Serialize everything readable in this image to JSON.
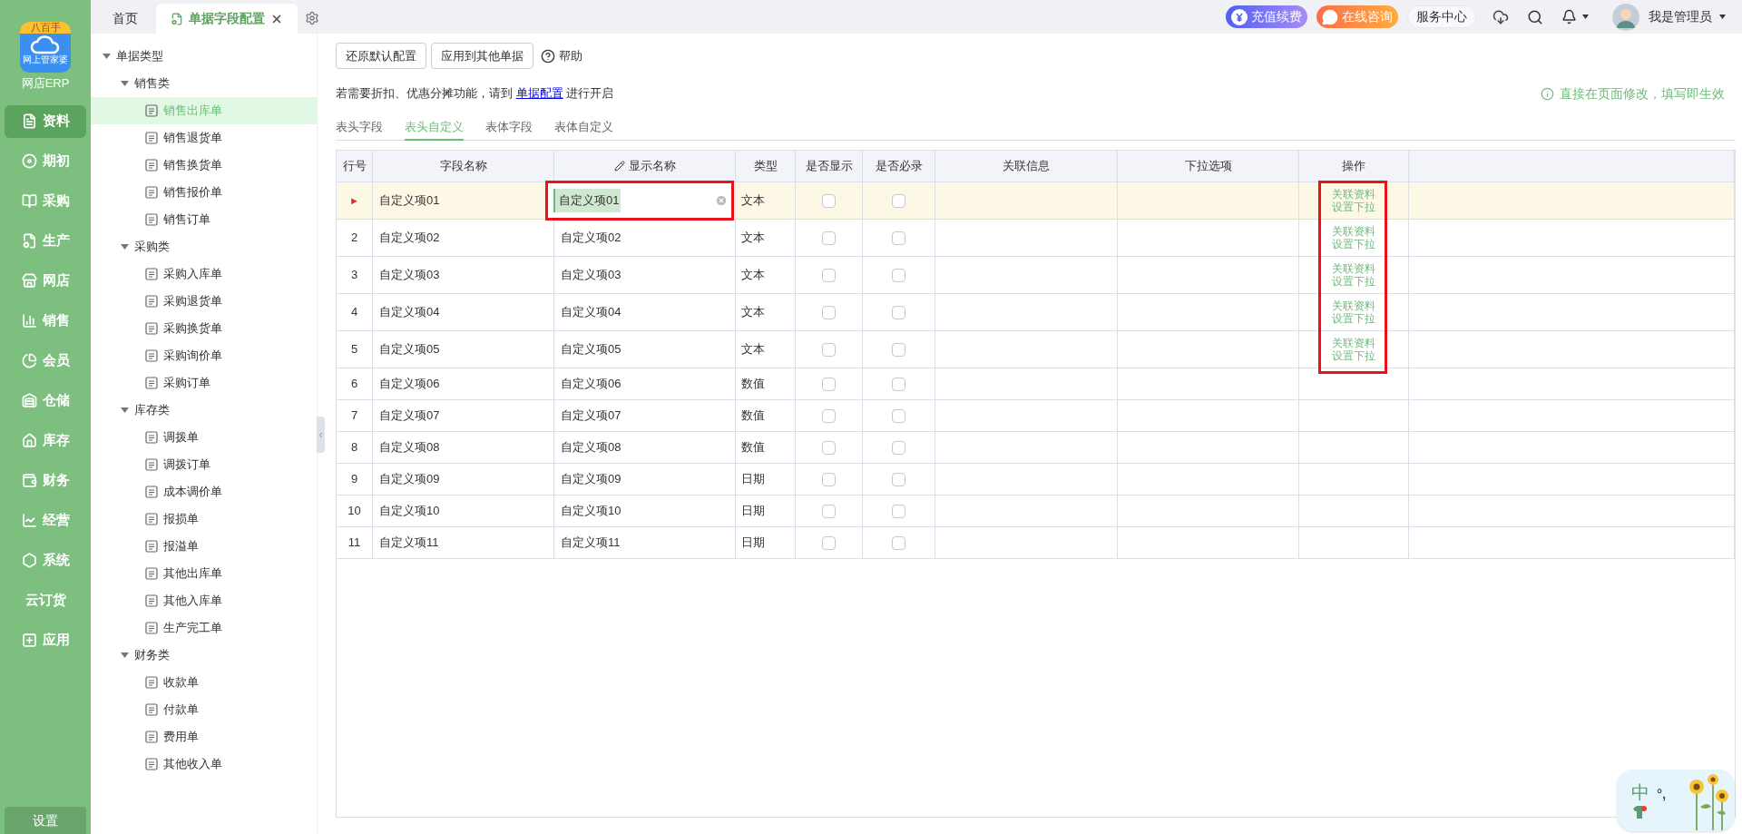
{
  "sidebar": {
    "logo_badge": "八百手",
    "logo_caption": "网上管家婆",
    "app_name": "网店ERP",
    "items": [
      {
        "label": "资料",
        "selected": true
      },
      {
        "label": "期初",
        "selected": false
      },
      {
        "label": "采购",
        "selected": false
      },
      {
        "label": "生产",
        "selected": false
      },
      {
        "label": "网店",
        "selected": false
      },
      {
        "label": "销售",
        "selected": false
      },
      {
        "label": "会员",
        "selected": false
      },
      {
        "label": "仓储",
        "selected": false
      },
      {
        "label": "库存",
        "selected": false
      },
      {
        "label": "财务",
        "selected": false
      },
      {
        "label": "经营",
        "selected": false
      },
      {
        "label": "系统",
        "selected": false
      },
      {
        "label": "云订货",
        "selected": false
      },
      {
        "label": "应用",
        "selected": false
      }
    ],
    "settings": "设置"
  },
  "tabs": [
    {
      "label": "首页",
      "selected": false,
      "closable": false
    },
    {
      "label": "单据字段配置",
      "selected": true,
      "closable": true
    }
  ],
  "header": {
    "recharge": "充值续费",
    "consult": "在线咨询",
    "service": "服务中心",
    "user": "我是管理员"
  },
  "tree": {
    "label": "单据类型",
    "expanded": true,
    "children": [
      {
        "label": "销售类",
        "expanded": true,
        "children": [
          {
            "label": "销售出库单",
            "selected": true
          },
          {
            "label": "销售退货单",
            "selected": false
          },
          {
            "label": "销售换货单",
            "selected": false
          },
          {
            "label": "销售报价单",
            "selected": false
          },
          {
            "label": "销售订单",
            "selected": false
          }
        ]
      },
      {
        "label": "采购类",
        "expanded": true,
        "children": [
          {
            "label": "采购入库单",
            "selected": false
          },
          {
            "label": "采购退货单",
            "selected": false
          },
          {
            "label": "采购换货单",
            "selected": false
          },
          {
            "label": "采购询价单",
            "selected": false
          },
          {
            "label": "采购订单",
            "selected": false
          }
        ]
      },
      {
        "label": "库存类",
        "expanded": true,
        "children": [
          {
            "label": "调拨单",
            "selected": false
          },
          {
            "label": "调拨订单",
            "selected": false
          },
          {
            "label": "成本调价单",
            "selected": false
          },
          {
            "label": "报损单",
            "selected": false
          },
          {
            "label": "报溢单",
            "selected": false
          },
          {
            "label": "其他出库单",
            "selected": false
          },
          {
            "label": "其他入库单",
            "selected": false
          },
          {
            "label": "生产完工单",
            "selected": false
          }
        ]
      },
      {
        "label": "财务类",
        "expanded": true,
        "children": [
          {
            "label": "收款单",
            "selected": false
          },
          {
            "label": "付款单",
            "selected": false
          },
          {
            "label": "费用单",
            "selected": false
          },
          {
            "label": "其他收入单",
            "selected": false
          }
        ]
      }
    ]
  },
  "toolbar": {
    "buttons": [
      "还原默认配置",
      "应用到其他单据"
    ],
    "help": "帮助"
  },
  "notice": {
    "before": "若需要折扣、优惠分摊功能，请到",
    "link": "单据配置",
    "after": "进行开启"
  },
  "tip": "直接在页面修改，填写即生效",
  "sub_tabs": [
    {
      "label": "表头字段",
      "selected": false
    },
    {
      "label": "表头自定义",
      "selected": true
    },
    {
      "label": "表体字段",
      "selected": false
    },
    {
      "label": "表体自定义",
      "selected": false
    }
  ],
  "table": {
    "columns": [
      "行号",
      "字段名称",
      "显示名称",
      "类型",
      "是否显示",
      "是否必录",
      "关联信息",
      "下拉选项",
      "操作"
    ],
    "actions_highlighted": true,
    "rows": [
      {
        "number": "►",
        "current": true,
        "field": "自定义项01",
        "display": "自定义项01",
        "editing": true,
        "type": "文本",
        "show": false,
        "required": false,
        "actions": [
          "关联资料",
          "设置下拉"
        ]
      },
      {
        "number": "2",
        "current": false,
        "field": "自定义项02",
        "display": "自定义项02",
        "editing": false,
        "type": "文本",
        "show": false,
        "required": false,
        "actions": [
          "关联资料",
          "设置下拉"
        ]
      },
      {
        "number": "3",
        "current": false,
        "field": "自定义项03",
        "display": "自定义项03",
        "editing": false,
        "type": "文本",
        "show": false,
        "required": false,
        "actions": [
          "关联资料",
          "设置下拉"
        ]
      },
      {
        "number": "4",
        "current": false,
        "field": "自定义项04",
        "display": "自定义项04",
        "editing": false,
        "type": "文本",
        "show": false,
        "required": false,
        "actions": [
          "关联资料",
          "设置下拉"
        ]
      },
      {
        "number": "5",
        "current": false,
        "field": "自定义项05",
        "display": "自定义项05",
        "editing": false,
        "type": "文本",
        "show": false,
        "required": false,
        "actions": [
          "关联资料",
          "设置下拉"
        ]
      },
      {
        "number": "6",
        "current": false,
        "field": "自定义项06",
        "display": "自定义项06",
        "editing": false,
        "type": "数值",
        "show": false,
        "required": false
      },
      {
        "number": "7",
        "current": false,
        "field": "自定义项07",
        "display": "自定义项07",
        "editing": false,
        "type": "数值",
        "show": false,
        "required": false
      },
      {
        "number": "8",
        "current": false,
        "field": "自定义项08",
        "display": "自定义项08",
        "editing": false,
        "type": "数值",
        "show": false,
        "required": false
      },
      {
        "number": "9",
        "current": false,
        "field": "自定义项09",
        "display": "自定义项09",
        "editing": false,
        "type": "日期",
        "show": false,
        "required": false
      },
      {
        "number": "10",
        "current": false,
        "field": "自定义项10",
        "display": "自定义项10",
        "editing": false,
        "type": "日期",
        "show": false,
        "required": false
      },
      {
        "number": "11",
        "current": false,
        "field": "自定义项11",
        "display": "自定义项11",
        "editing": false,
        "type": "日期",
        "show": false,
        "required": false
      }
    ]
  },
  "ime": {
    "mode": "中",
    "punct": "°,"
  }
}
